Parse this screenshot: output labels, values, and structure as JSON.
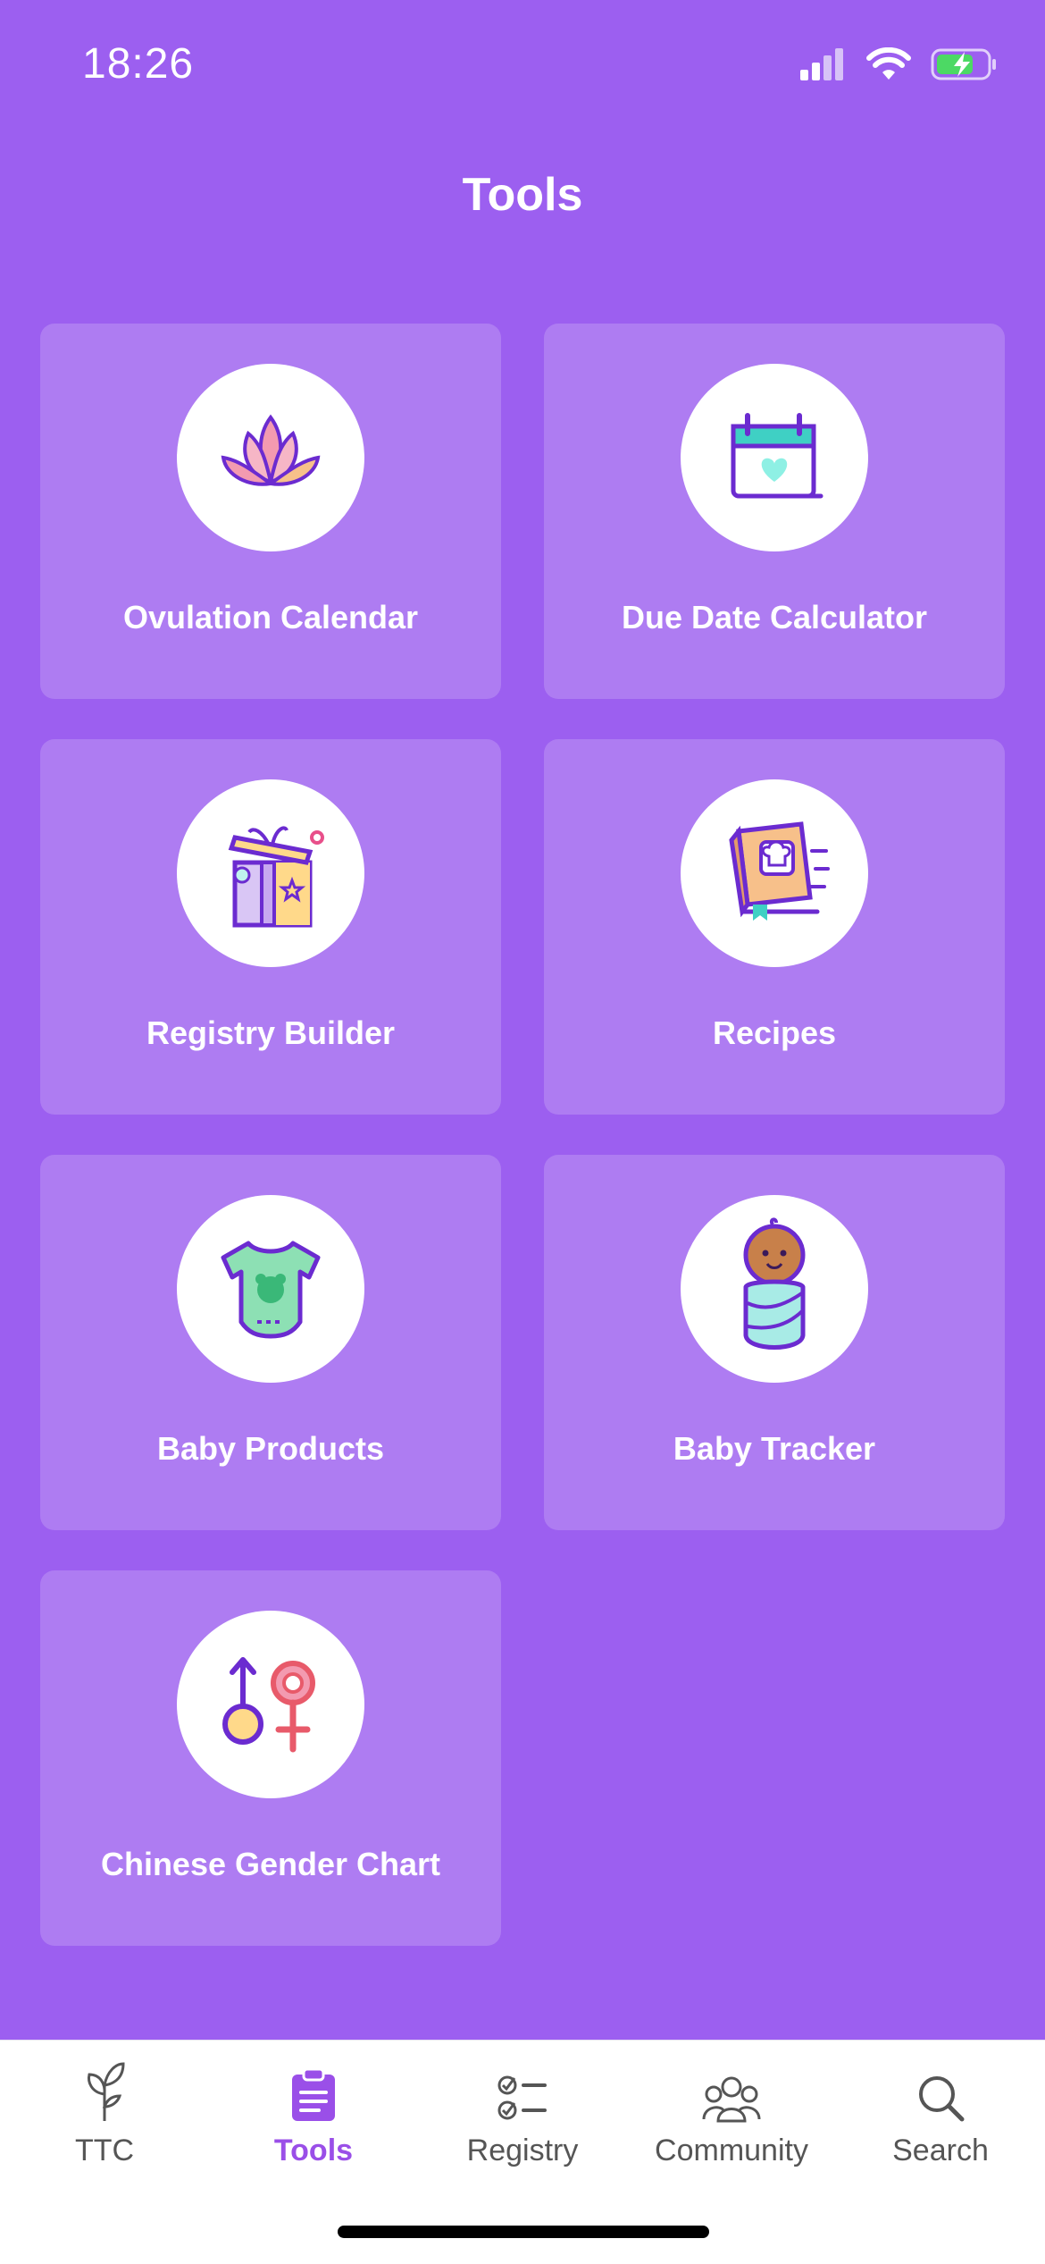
{
  "status": {
    "time": "18:26"
  },
  "header": {
    "title": "Tools"
  },
  "tools": [
    {
      "label": "Ovulation Calendar",
      "icon": "lotus-icon"
    },
    {
      "label": "Due Date Calculator",
      "icon": "calendar-heart-icon"
    },
    {
      "label": "Registry Builder",
      "icon": "gift-box-icon"
    },
    {
      "label": "Recipes",
      "icon": "cookbook-icon"
    },
    {
      "label": "Baby Products",
      "icon": "onesie-icon"
    },
    {
      "label": "Baby Tracker",
      "icon": "swaddled-baby-icon"
    },
    {
      "label": "Chinese Gender Chart",
      "icon": "gender-symbols-icon"
    }
  ],
  "tabs": [
    {
      "label": "TTC",
      "icon": "sprout-icon"
    },
    {
      "label": "Tools",
      "icon": "clipboard-icon",
      "active": true
    },
    {
      "label": "Registry",
      "icon": "checklist-icon"
    },
    {
      "label": "Community",
      "icon": "people-icon"
    },
    {
      "label": "Search",
      "icon": "search-icon"
    }
  ],
  "colors": {
    "background": "#9c5ff0",
    "card": "#ae7cf2",
    "accent": "#9a4fe8"
  }
}
